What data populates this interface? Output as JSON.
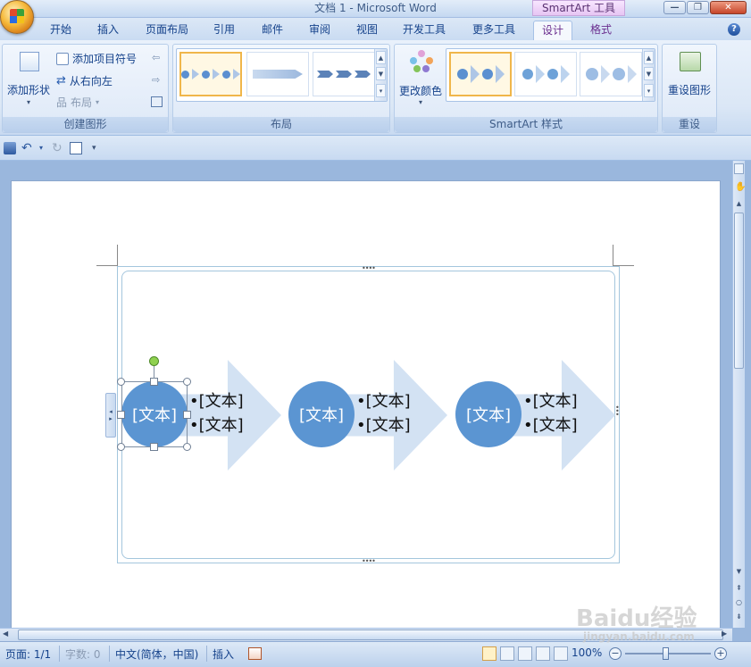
{
  "title_bar": {
    "title": "文档 1 - Microsoft Word",
    "context_tools": "SmartArt 工具"
  },
  "window_buttons": {
    "minimize": "—",
    "restore": "❐",
    "close": "✕"
  },
  "tabs": [
    {
      "label": "开始"
    },
    {
      "label": "插入"
    },
    {
      "label": "页面布局"
    },
    {
      "label": "引用"
    },
    {
      "label": "邮件"
    },
    {
      "label": "审阅"
    },
    {
      "label": "视图"
    },
    {
      "label": "开发工具"
    },
    {
      "label": "更多工具"
    },
    {
      "label": "设计"
    },
    {
      "label": "格式"
    }
  ],
  "help_glyph": "?",
  "ribbon": {
    "create_group": {
      "label": "创建图形",
      "add_shape": "添加形状",
      "add_bullet": "添加项目符号",
      "right_to_left": "从右向左",
      "layout": "布局"
    },
    "layout_group": {
      "label": "布局"
    },
    "styles_group": {
      "label": "SmartArt 样式",
      "change_colors": "更改颜色"
    },
    "reset_group": {
      "label": "重设",
      "reset_graphic": "重设图形"
    }
  },
  "quick_access": {
    "customize_glyph": "▾"
  },
  "smartart": {
    "items": [
      {
        "circle_text": "[文本]",
        "bullets": [
          "[文本]",
          "[文本]"
        ]
      },
      {
        "circle_text": "[文本]",
        "bullets": [
          "[文本]",
          "[文本]"
        ]
      },
      {
        "circle_text": "[文本]",
        "bullets": [
          "[文本]",
          "[文本]"
        ]
      }
    ]
  },
  "status_bar": {
    "page": "页面: 1/1",
    "words": "字数: 0",
    "language": "中文(简体，中国)",
    "mode": "插入",
    "zoom": "100%"
  },
  "watermark": {
    "brand": "Baidu经验",
    "url": "jingyan.baidu.com"
  },
  "colors": {
    "accent_circle": "#5b95d2",
    "arrow_fill": "#d3e2f3",
    "ribbon": "#dbe7f6"
  }
}
